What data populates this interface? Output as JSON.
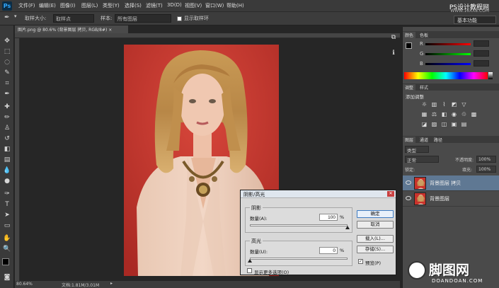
{
  "app": {
    "logo": "Ps"
  },
  "menu": [
    "文件(F)",
    "编辑(E)",
    "图像(I)",
    "图层(L)",
    "类型(Y)",
    "选择(S)",
    "滤镜(T)",
    "3D(D)",
    "视图(V)",
    "窗口(W)",
    "帮助(H)"
  ],
  "watermark_top": {
    "title": "PS设计教程网",
    "url": "WWW.16XX8.COM"
  },
  "options": {
    "size_label": "取样大小:",
    "size_value": "取样点",
    "sample_label": "样本:",
    "sample_value": "所有图层",
    "show_ring": "显示取样环",
    "workspace": "基本功能"
  },
  "document": {
    "tab": "图片.png @ 80.6% (背景图层 拷贝, RGB/8#) ×",
    "zoom": "80.64%",
    "doc_size": "文档:1.81M/3.01M"
  },
  "panels": {
    "color_tabs": [
      "颜色",
      "色板"
    ],
    "channels": [
      "R",
      "G",
      "B"
    ],
    "adjust_tabs": [
      "调整",
      "样式"
    ],
    "adjust_heading": "添加调整",
    "layers_tabs": [
      "图层",
      "通道",
      "路径"
    ],
    "kind_label": "类型",
    "blend_mode": "正常",
    "opacity_label": "不透明度:",
    "opacity_value": "100%",
    "lock_label": "锁定:",
    "fill_label": "填充:",
    "fill_value": "100%",
    "layers": [
      {
        "name": "背景图层 拷贝",
        "selected": true
      },
      {
        "name": "背景图层",
        "selected": false
      }
    ]
  },
  "dialog": {
    "title": "阴影/高光",
    "shadows": {
      "title": "阴影",
      "label": "数量(A):",
      "value": "100",
      "unit": "%",
      "level": 1.0
    },
    "highlights": {
      "title": "高光",
      "label": "数量(U):",
      "value": "0",
      "unit": "%",
      "level": 0.0
    },
    "buttons": {
      "ok": "确定",
      "cancel": "取消",
      "load": "载入(L)...",
      "save": "存储(S)..."
    },
    "preview": "预览(P)",
    "more_options": "显示更多选项(O)"
  },
  "watermark_bottom": {
    "brand": "脚图网",
    "url": "DOANDOAN.COM"
  },
  "colors": {
    "accent": "#31a8ff",
    "photo_bg": "#c9322b",
    "panel": "#4a4a4a",
    "dark": "#262626"
  }
}
